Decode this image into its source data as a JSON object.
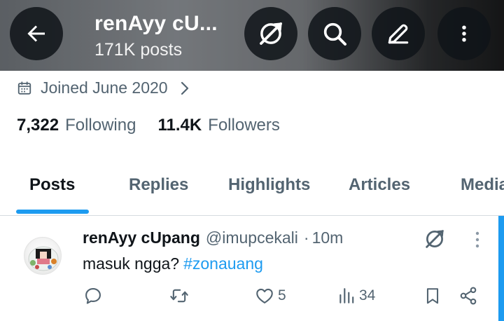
{
  "header": {
    "name": "renAyy cU...",
    "posts_count": "171K posts",
    "icons": {
      "back": "back-arrow-icon",
      "grok": "grok-icon",
      "search": "search-icon",
      "edit": "edit-icon",
      "more": "more-vertical-icon"
    }
  },
  "profile": {
    "joined": "Joined June 2020",
    "following_count": "7,322",
    "following_label": "Following",
    "followers_count": "11.4K",
    "followers_label": "Followers"
  },
  "tabs": [
    {
      "label": "Posts",
      "active": true
    },
    {
      "label": "Replies",
      "active": false
    },
    {
      "label": "Highlights",
      "active": false
    },
    {
      "label": "Articles",
      "active": false
    },
    {
      "label": "Media",
      "active": false
    }
  ],
  "post": {
    "display_name": "renAyy cUpang",
    "handle": "@imupcekali",
    "separator": "·",
    "time": "10m",
    "text": "masuk ngga?",
    "hashtag": "#zonauang",
    "actions": {
      "reply_count": "",
      "repost_count": "",
      "like_count": "5",
      "views_count": "34"
    }
  },
  "colors": {
    "accent": "#1d9bf0",
    "text_primary": "#0f1419",
    "text_secondary": "#536471"
  }
}
